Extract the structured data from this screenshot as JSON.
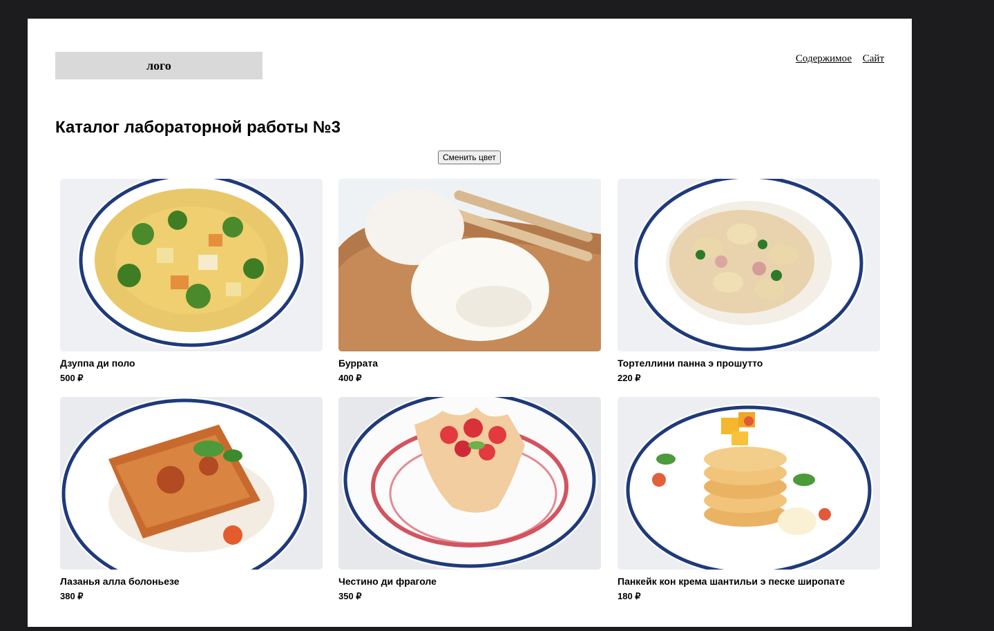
{
  "header": {
    "logo": "лого",
    "nav": [
      {
        "label": "Содержимое"
      },
      {
        "label": "Сайт"
      }
    ]
  },
  "main": {
    "title": "Каталог лабораторной работы №3",
    "change_color_label": "Сменить цвет"
  },
  "products": [
    {
      "name": "Дзуппа ди поло",
      "price": "500 ₽",
      "image": "chicken-soup-photo"
    },
    {
      "name": "Буррата",
      "price": "400 ₽",
      "image": "burrata-photo"
    },
    {
      "name": "Тортеллини панна э прошутто",
      "price": "220 ₽",
      "image": "tortellini-photo"
    },
    {
      "name": "Лазанья алла болоньезе",
      "price": "380 ₽",
      "image": "lasagna-photo"
    },
    {
      "name": "Честино ди фраголе",
      "price": "350 ₽",
      "image": "strawberry-basket-photo"
    },
    {
      "name": "Панкейк кон крема шантильи э песке широпате",
      "price": "180 ₽",
      "image": "pancakes-photo"
    }
  ]
}
